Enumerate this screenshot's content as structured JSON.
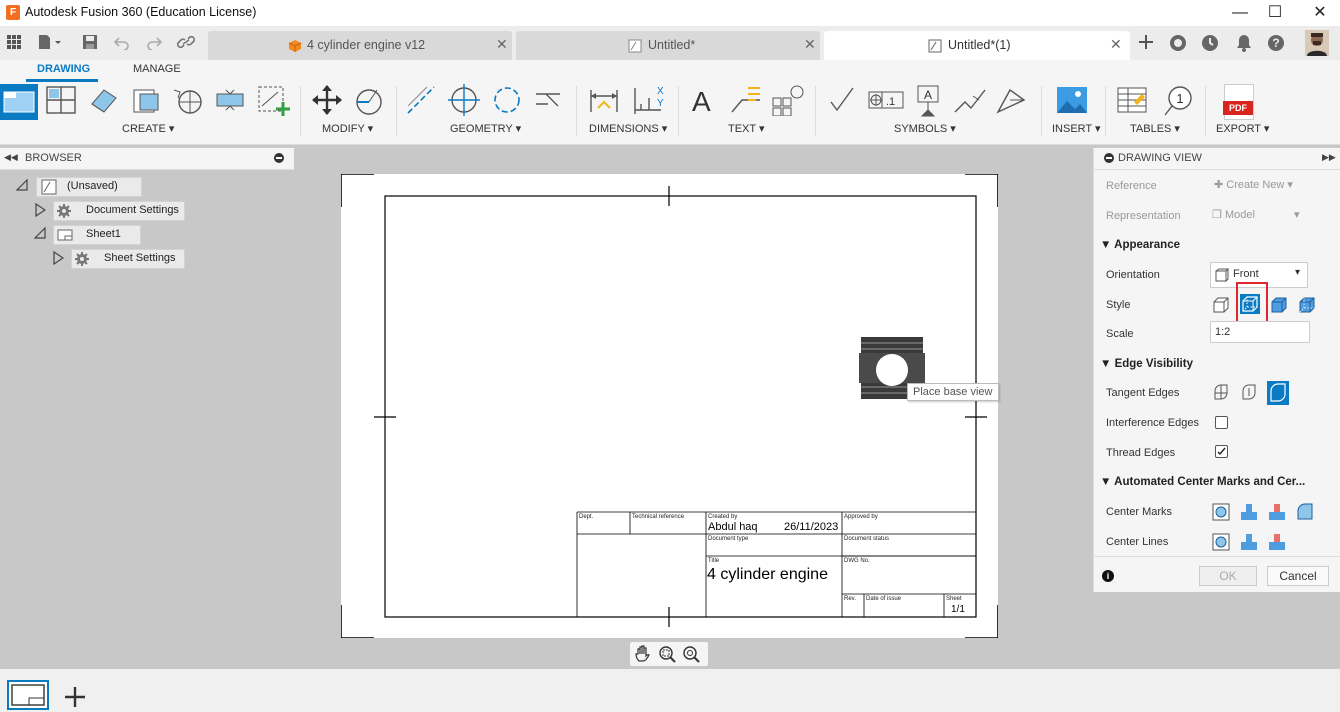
{
  "app": {
    "title": "Autodesk Fusion 360 (Education License)",
    "icon_letter": "F"
  },
  "tabs": [
    {
      "label": "4 cylinder engine v12"
    },
    {
      "label": "Untitled*"
    },
    {
      "label": "Untitled*(1)"
    }
  ],
  "ribbon": {
    "tabs": [
      "DRAWING",
      "MANAGE"
    ],
    "groups": [
      "CREATE",
      "MODIFY",
      "GEOMETRY",
      "DIMENSIONS",
      "TEXT",
      "SYMBOLS",
      "INSERT",
      "TABLES",
      "EXPORT"
    ],
    "text_tool_glyph": "A",
    "pdf_label": "PDF",
    "balloon_number": "1"
  },
  "browser": {
    "header": "BROWSER",
    "root": "(Unsaved)",
    "items": [
      {
        "label": "Document Settings"
      },
      {
        "label": "Sheet1"
      },
      {
        "label": "Sheet Settings"
      }
    ]
  },
  "canvas": {
    "tooltip": "Place base view"
  },
  "title_block": {
    "dept": "Dept.",
    "tech_ref": "Technical reference",
    "created_by_label": "Created by",
    "created_by": "Abdul haq",
    "date": "26/11/2023",
    "approved_by": "Approved by",
    "doc_type": "Document type",
    "doc_status": "Document status",
    "title_label": "Title",
    "title": "4 cylinder engine",
    "dwg_no": "DWG No.",
    "rev": "Rev.",
    "date_of_issue": "Date of issue",
    "sheet_label": "Sheet",
    "sheet": "1/1"
  },
  "drawing_view": {
    "header": "DRAWING VIEW",
    "reference_label": "Reference",
    "reference_value": "Create New",
    "representation_label": "Representation",
    "representation_value": "Model",
    "appearance": "Appearance",
    "orientation_label": "Orientation",
    "orientation_value": "Front",
    "style_label": "Style",
    "scale_label": "Scale",
    "scale_value": "1:2",
    "edge_visibility": "Edge Visibility",
    "tangent_edges": "Tangent Edges",
    "interference_edges": "Interference Edges",
    "thread_edges": "Thread Edges",
    "automated": "Automated Center Marks and Cer...",
    "center_marks": "Center Marks",
    "center_lines": "Center Lines",
    "ok": "OK",
    "cancel": "Cancel",
    "info_glyph": "i"
  },
  "colors": {
    "accent": "#0a7ac2",
    "highlight": "#e0262d",
    "pdf": "#d9261c",
    "brand": "#f26f21"
  }
}
